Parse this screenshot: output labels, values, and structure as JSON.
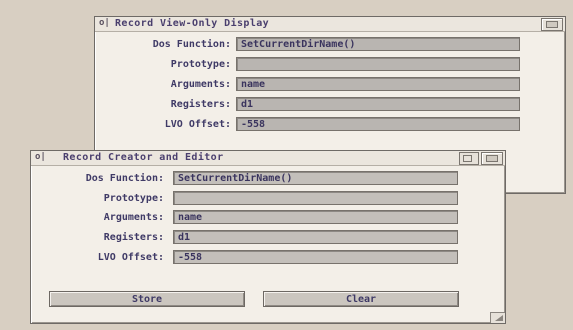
{
  "view_window": {
    "close_glyph": "o|",
    "title": "Record View-Only Display",
    "fields": [
      {
        "label": "Dos Function:",
        "value": "SetCurrentDirName()"
      },
      {
        "label": "Prototype:",
        "value": ""
      },
      {
        "label": "Arguments:",
        "value": "name"
      },
      {
        "label": "Registers:",
        "value": "d1"
      },
      {
        "label": "LVO Offset:",
        "value": "-558"
      }
    ]
  },
  "editor_window": {
    "close_glyph": "o|",
    "title": "Record Creator and Editor",
    "fields": [
      {
        "label": "Dos Function:",
        "value": "SetCurrentDirName()"
      },
      {
        "label": "Prototype:",
        "value": ""
      },
      {
        "label": "Arguments:",
        "value": "name"
      },
      {
        "label": "Registers:",
        "value": "d1"
      },
      {
        "label": "LVO Offset:",
        "value": "-558"
      }
    ],
    "store_label": "Store",
    "clear_label": "Clear"
  },
  "colors": {
    "desktop": "#d8cfc2",
    "window": "#f3efe8",
    "field": "#b9b5b1",
    "text": "#3f3a66"
  }
}
